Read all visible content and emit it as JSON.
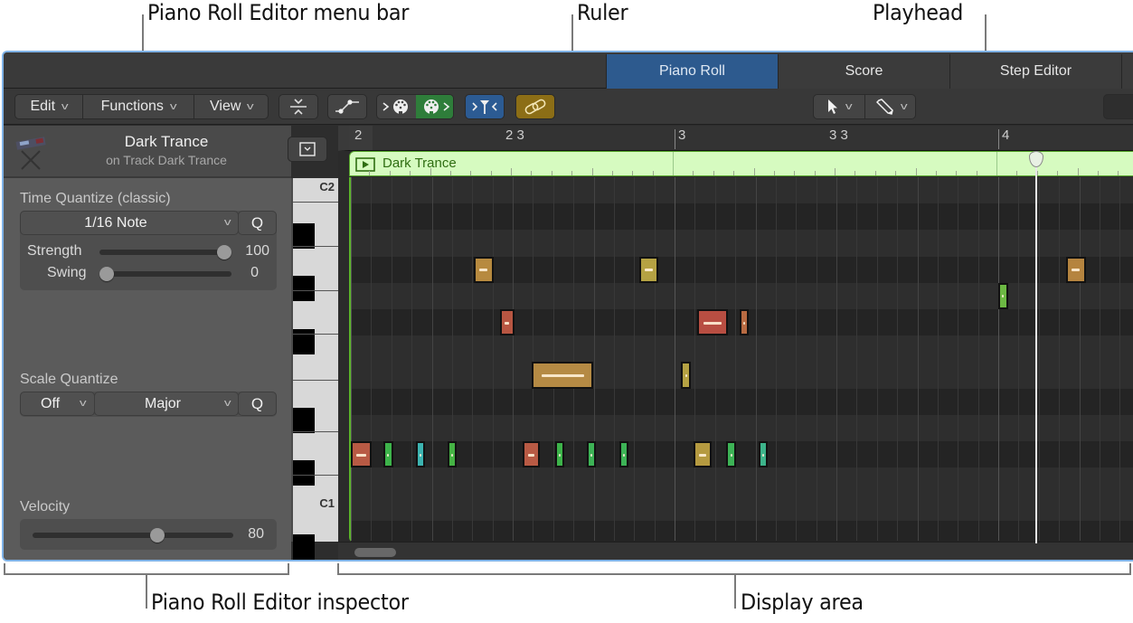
{
  "callouts": {
    "menu_bar": "Piano Roll Editor menu bar",
    "ruler": "Ruler",
    "playhead": "Playhead",
    "inspector": "Piano Roll Editor inspector",
    "display_area": "Display area"
  },
  "tabs": [
    {
      "label": "Piano Roll",
      "active": true
    },
    {
      "label": "Score",
      "active": false
    },
    {
      "label": "Step Editor",
      "active": false
    }
  ],
  "toolbar": {
    "menus": [
      {
        "label": "Edit",
        "icon": "chevron-down-icon"
      },
      {
        "label": "Functions",
        "icon": "chevron-down-icon"
      },
      {
        "label": "View",
        "icon": "chevron-down-icon"
      }
    ],
    "buttons": [
      {
        "name": "collapse-button",
        "icon": "collapse-vertical-icon"
      },
      {
        "name": "automation-button",
        "icon": "automation-curve-icon"
      },
      {
        "name": "midi-in-button",
        "icon": "midi-in-icon"
      },
      {
        "name": "midi-out-button",
        "icon": "midi-out-icon",
        "active_color": "#2e7d3a"
      },
      {
        "name": "catch-playhead-button",
        "icon": "catch-icon",
        "active_color": "#2c5b93"
      },
      {
        "name": "link-button",
        "icon": "link-icon",
        "active_color": "#8c6e16"
      }
    ],
    "tools": [
      {
        "name": "pointer-tool",
        "icon": "pointer-arrow-icon"
      },
      {
        "name": "pencil-tool",
        "icon": "pencil-icon"
      }
    ]
  },
  "inspector": {
    "region_name": "Dark Trance",
    "track_line": "on Track Dark Trance",
    "instrument_icon": "keyboard-stand-icon",
    "time_quantize": {
      "label": "Time Quantize (classic)",
      "value": "1/16 Note",
      "q_label": "Q",
      "strength_label": "Strength",
      "strength_value": "100",
      "strength_fraction": 1.0,
      "swing_label": "Swing",
      "swing_value": "0",
      "swing_fraction": 0.0
    },
    "scale_quantize": {
      "label": "Scale Quantize",
      "root": "Off",
      "scale": "Major",
      "q_label": "Q"
    },
    "velocity": {
      "label": "Velocity",
      "value": "80",
      "fraction": 0.63
    }
  },
  "keyboard": {
    "labels": [
      "C2",
      "C1"
    ]
  },
  "ruler": {
    "marks": [
      {
        "label": "2",
        "bar": 2.0
      },
      {
        "label": "2 3",
        "bar": 2.5
      },
      {
        "label": "3",
        "bar": 3.0
      },
      {
        "label": "3 3",
        "bar": 3.5
      },
      {
        "label": "4",
        "bar": 4.0
      }
    ]
  },
  "region": {
    "name": "Dark Trance",
    "color": "#d6fbc0",
    "icon": "play-icon"
  },
  "playhead": {
    "bar": 4.12
  },
  "notes": [
    {
      "row": 3,
      "start": 2.38,
      "len": 0.06,
      "color": "#b78a3f"
    },
    {
      "row": 3,
      "start": 2.89,
      "len": 0.06,
      "color": "#b5a243"
    },
    {
      "row": 3,
      "start": 4.21,
      "len": 0.06,
      "color": "#b5843f"
    },
    {
      "row": 4,
      "start": 4.0,
      "len": 0.03,
      "color": "#6cb843"
    },
    {
      "row": 5,
      "start": 2.46,
      "len": 0.045,
      "color": "#b85642"
    },
    {
      "row": 5,
      "start": 3.07,
      "len": 0.095,
      "color": "#b84e42"
    },
    {
      "row": 5,
      "start": 3.2,
      "len": 0.03,
      "color": "#b86a42"
    },
    {
      "row": 7,
      "start": 2.56,
      "len": 0.19,
      "color": "#b58a44"
    },
    {
      "row": 7,
      "start": 3.02,
      "len": 0.03,
      "color": "#b5a243"
    },
    {
      "row": 10,
      "start": 2.0,
      "len": 0.065,
      "color": "#b85a44"
    },
    {
      "row": 10,
      "start": 2.1,
      "len": 0.03,
      "color": "#3db34a"
    },
    {
      "row": 10,
      "start": 2.2,
      "len": 0.02,
      "color": "#3cb3b0"
    },
    {
      "row": 10,
      "start": 2.3,
      "len": 0.015,
      "color": "#45b344"
    },
    {
      "row": 10,
      "start": 2.53,
      "len": 0.055,
      "color": "#b85a44"
    },
    {
      "row": 10,
      "start": 2.63,
      "len": 0.025,
      "color": "#3db34a"
    },
    {
      "row": 10,
      "start": 2.73,
      "len": 0.015,
      "color": "#3db356"
    },
    {
      "row": 10,
      "start": 2.83,
      "len": 0.015,
      "color": "#3db356"
    },
    {
      "row": 10,
      "start": 3.06,
      "len": 0.055,
      "color": "#b59a40"
    },
    {
      "row": 10,
      "start": 3.16,
      "len": 0.03,
      "color": "#3db356"
    },
    {
      "row": 10,
      "start": 3.26,
      "len": 0.015,
      "color": "#3db38a"
    }
  ]
}
